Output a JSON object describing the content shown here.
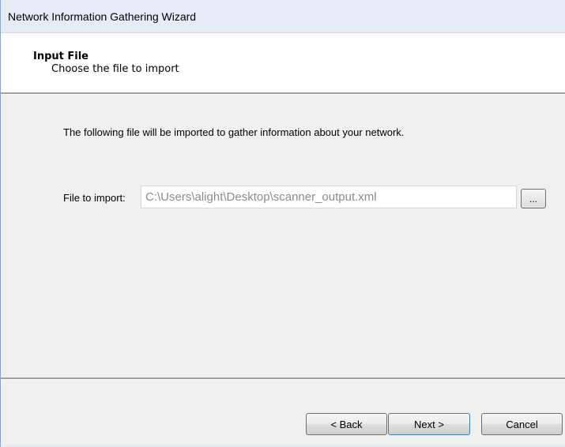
{
  "window": {
    "title": "Network Information Gathering Wizard"
  },
  "header": {
    "title": "Input File",
    "subtitle": "Choose the file to import"
  },
  "content": {
    "description": "The following file will be imported to gather information about your network.",
    "file_label": "File to import:",
    "file_value": "C:\\Users\\alight\\Desktop\\scanner_output.xml",
    "browse_label": "..."
  },
  "buttons": {
    "back": "< Back",
    "next": "Next >",
    "cancel": "Cancel"
  }
}
